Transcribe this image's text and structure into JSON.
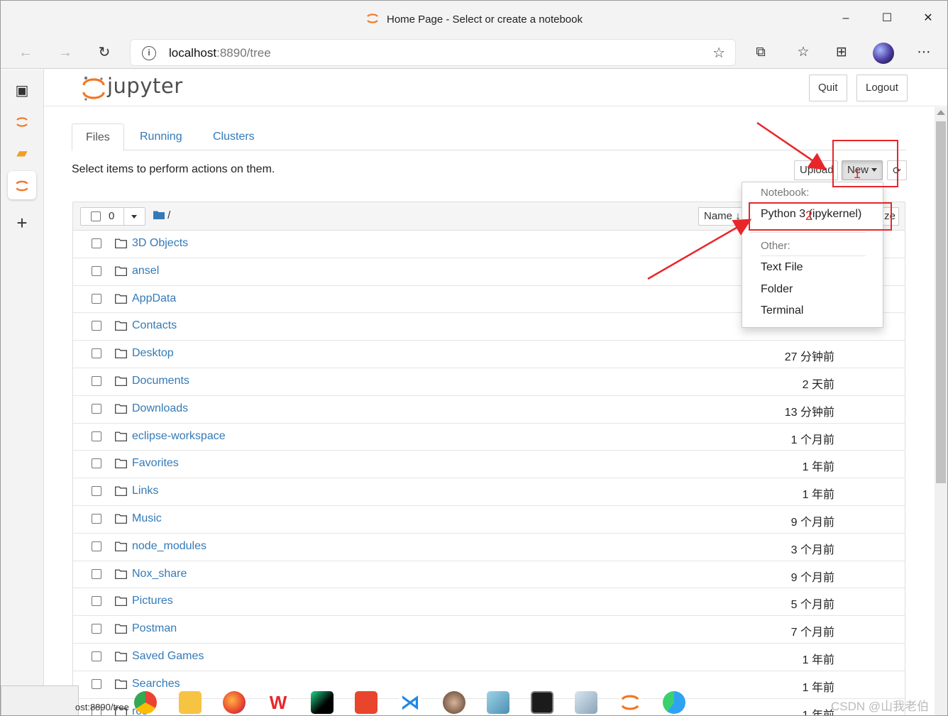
{
  "window": {
    "title": "Home Page - Select or create a notebook",
    "controls": {
      "minimize": "–",
      "maximize": "☐",
      "close": "✕"
    }
  },
  "browser": {
    "url_host": "localhost",
    "url_rest": ":8890/tree",
    "icons": [
      "back-icon",
      "forward-icon",
      "refresh-icon",
      "info-icon",
      "favorite-add-icon",
      "extensions-icon",
      "favorites-icon",
      "collections-icon",
      "profile-avatar",
      "more-icon"
    ]
  },
  "header": {
    "logo_text": "jupyter",
    "quit_label": "Quit",
    "logout_label": "Logout"
  },
  "tabs": [
    {
      "label": "Files"
    },
    {
      "label": "Running"
    },
    {
      "label": "Clusters"
    }
  ],
  "toolbar": {
    "hint": "Select items to perform actions on them.",
    "upload_label": "Upload",
    "new_label": "New"
  },
  "list": {
    "selected_count": "0",
    "breadcrumb": "/",
    "name_sort_label": "Name",
    "size_sort_label": "ze",
    "rows": [
      {
        "name": "3D Objects",
        "modified": ""
      },
      {
        "name": "ansel",
        "modified": ""
      },
      {
        "name": "AppData",
        "modified": ""
      },
      {
        "name": "Contacts",
        "modified": ""
      },
      {
        "name": "Desktop",
        "modified": "27 分钟前"
      },
      {
        "name": "Documents",
        "modified": "2 天前"
      },
      {
        "name": "Downloads",
        "modified": "13 分钟前"
      },
      {
        "name": "eclipse-workspace",
        "modified": "1 个月前"
      },
      {
        "name": "Favorites",
        "modified": "1 年前"
      },
      {
        "name": "Links",
        "modified": "1 年前"
      },
      {
        "name": "Music",
        "modified": "9 个月前"
      },
      {
        "name": "node_modules",
        "modified": "3 个月前"
      },
      {
        "name": "Nox_share",
        "modified": "9 个月前"
      },
      {
        "name": "Pictures",
        "modified": "5 个月前"
      },
      {
        "name": "Postman",
        "modified": "7 个月前"
      },
      {
        "name": "Saved Games",
        "modified": "1 年前"
      },
      {
        "name": "Searches",
        "modified": "1 年前"
      },
      {
        "name": "rce",
        "modified": "1 年前"
      }
    ]
  },
  "new_menu": {
    "notebook_header": "Notebook:",
    "python_kernel": "Python 3 (ipykernel)",
    "other_header": "Other:",
    "text_file": "Text File",
    "folder": "Folder",
    "terminal": "Terminal"
  },
  "annotations": {
    "label_1": "1",
    "label_2": "2",
    "color": "#e8262a"
  },
  "status_bar": {
    "text": "ost:8890/tree"
  },
  "watermark": "CSDN @山我老伯"
}
